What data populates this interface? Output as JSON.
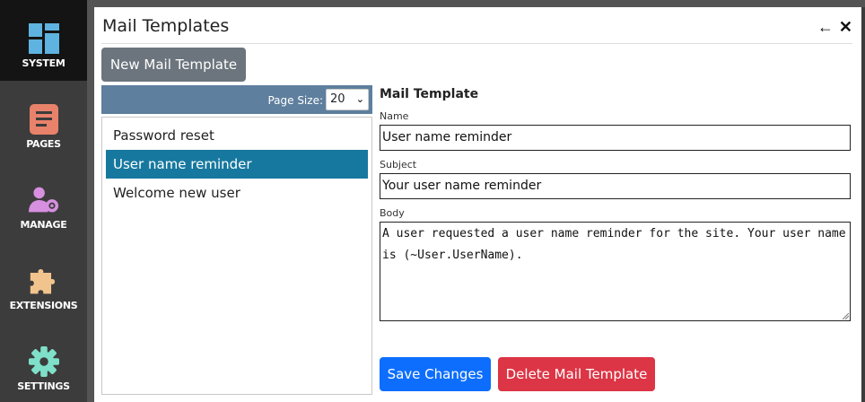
{
  "sidebar": {
    "items": [
      {
        "label": "SYSTEM",
        "icon": "system-icon",
        "color": "#5fb3e0"
      },
      {
        "label": "PAGES",
        "icon": "pages-icon",
        "color": "#e8826b"
      },
      {
        "label": "MANAGE",
        "icon": "manage-users-icon",
        "color": "#d78fe0"
      },
      {
        "label": "EXTENSIONS",
        "icon": "puzzle-icon",
        "color": "#f2c48d"
      },
      {
        "label": "SETTINGS",
        "icon": "gear-icon",
        "color": "#7fe0c9"
      }
    ],
    "active": "SYSTEM"
  },
  "panel": {
    "title": "Mail Templates",
    "back_icon": "arrow-left-icon",
    "close_icon": "close-icon"
  },
  "toolbar": {
    "new_label": "New Mail Template"
  },
  "list": {
    "page_size_label": "Page Size:",
    "page_size_value": "20",
    "items": [
      "Password reset",
      "User name reminder",
      "Welcome new user"
    ],
    "selected_index": 1
  },
  "form": {
    "title": "Mail Template",
    "name_label": "Name",
    "name_value": "User name reminder",
    "subject_label": "Subject",
    "subject_value": "Your user name reminder",
    "body_label": "Body",
    "body_value": "A user requested a user name reminder for the site. Your user name is (~User.UserName).",
    "save_label": "Save Changes",
    "delete_label": "Delete Mail Template"
  },
  "colors": {
    "save": "#0d6efd",
    "delete": "#dc3545",
    "secondary": "#6c757d",
    "selected_row": "#17789f",
    "list_header": "#5e7f9e"
  }
}
